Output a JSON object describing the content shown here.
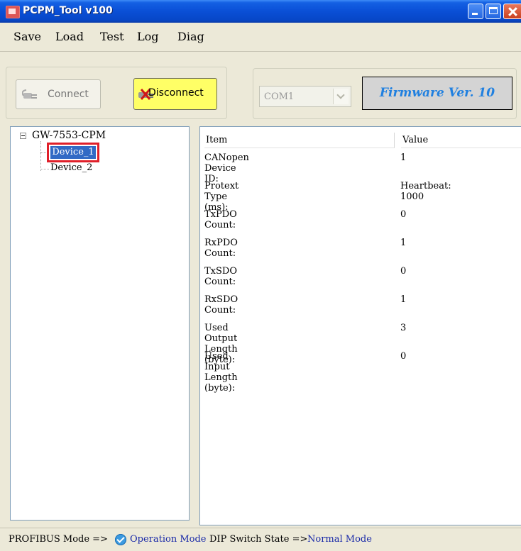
{
  "window": {
    "title": "PCPM_Tool v100"
  },
  "menu": [
    "Save",
    "Load",
    "Test",
    "Log",
    "Diag"
  ],
  "toolbar": {
    "connect_label": "Connect",
    "disconnect_label": "Disconnect",
    "com_port": "COM1",
    "firmware": "Firmware Ver. 10"
  },
  "tree": {
    "root": "GW-7553-CPM",
    "nodes": [
      "Device_1",
      "Device_2"
    ],
    "selected": "Device_1"
  },
  "table": {
    "columns": [
      "Item",
      "Value"
    ],
    "rows": [
      {
        "item": "CANopen Device ID:",
        "value": "1"
      },
      {
        "item": "Protext Type (ms):",
        "value": "Heartbeat: 1000"
      },
      {
        "item": "TxPDO Count:",
        "value": "0"
      },
      {
        "item": "RxPDO Count:",
        "value": "1"
      },
      {
        "item": "TxSDO Count:",
        "value": "0"
      },
      {
        "item": "RxSDO Count:",
        "value": "1"
      },
      {
        "item": "Used Output Length (byte):",
        "value": "3"
      },
      {
        "item": "Used Input Length (byte):",
        "value": "0"
      }
    ]
  },
  "status": {
    "profibus_label": "PROFIBUS Mode =>",
    "profibus_value": "Operation Mode",
    "dip_label": "DIP Switch State =>",
    "dip_value": "Normal Mode"
  },
  "colors": {
    "title_bar": "#0a4fd6",
    "selection": "#316ac5",
    "highlight_box": "#e0202a",
    "firmware_text": "#2080e0",
    "status_value": "#1a2aa8",
    "disconnect_bg": "#ffff66"
  }
}
